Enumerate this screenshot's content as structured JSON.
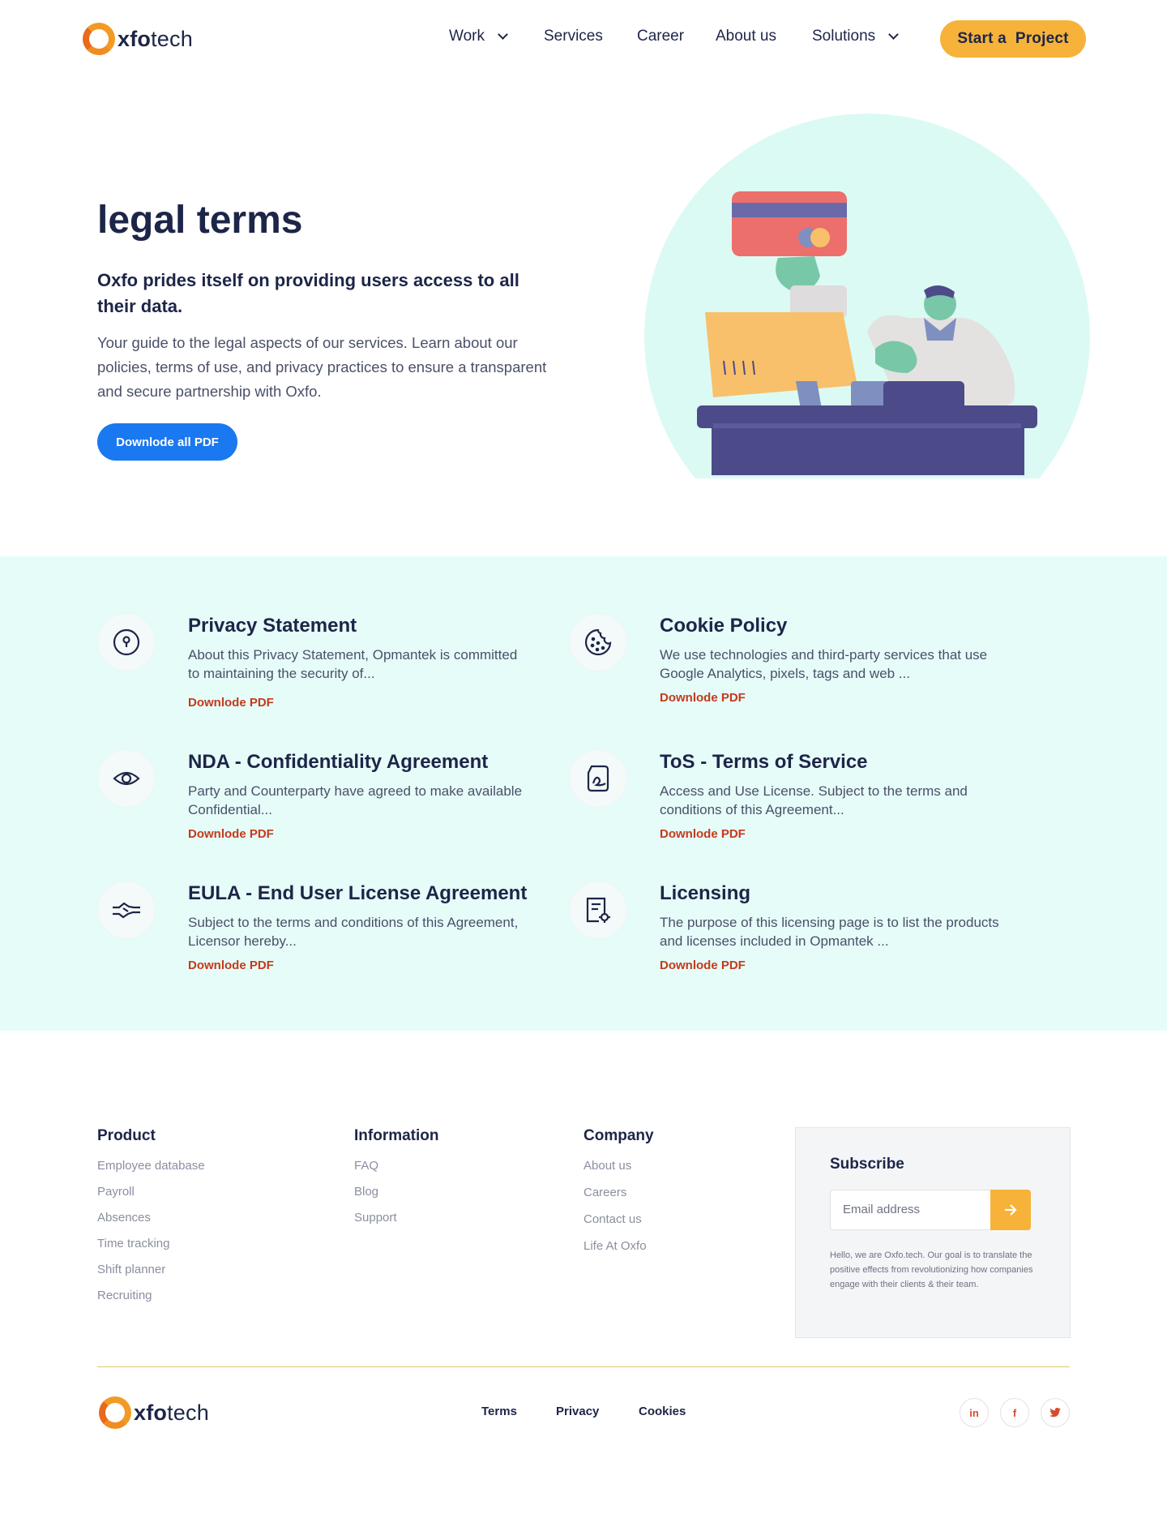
{
  "brand": {
    "logo_text_bold": "xfo",
    "logo_text_rest": "tech",
    "accent": "#f6b239",
    "link_color": "#c43a1a",
    "primary": "#1a78f0",
    "navy": "#1d2548"
  },
  "nav": {
    "items": [
      {
        "label": "Work",
        "has_dropdown": true
      },
      {
        "label": "Services",
        "has_dropdown": false
      },
      {
        "label": "Career",
        "has_dropdown": false
      },
      {
        "label": "About us",
        "has_dropdown": false
      },
      {
        "label": "Solutions",
        "has_dropdown": true
      }
    ],
    "cta": "Start a  Project"
  },
  "hero": {
    "title": "legal terms",
    "subtitle": "Oxfo prides itself on providing users access to all their data.",
    "description": "Your guide to the legal aspects of our services. Learn about our policies, terms of use, and privacy practices to ensure a transparent and secure partnership with Oxfo.",
    "button": "Downlode all PDF"
  },
  "documents": [
    {
      "icon": "keyhole-icon",
      "title": "Privacy Statement",
      "description": "About this Privacy Statement, Opmantek is committed to maintaining the security of...",
      "link": "Downlode PDF"
    },
    {
      "icon": "cookie-icon",
      "title": "Cookie Policy",
      "description": "We use technologies and third-party services that use Google Analytics, pixels, tags and web ...",
      "link": "Downlode PDF"
    },
    {
      "icon": "eye-icon",
      "title": "NDA - Confidentiality Agreement",
      "description": "Party and Counterparty have agreed to make available Confidential...",
      "link": "Downlode PDF"
    },
    {
      "icon": "signed-document-icon",
      "title": "ToS - Terms of Service",
      "description": "Access and Use License. Subject to the terms and conditions of this Agreement...",
      "link": "Downlode PDF"
    },
    {
      "icon": "handshake-icon",
      "title": "EULA - End User License Agreement",
      "description": "Subject to the terms and conditions of this Agreement, Licensor hereby...",
      "link": "Downlode PDF"
    },
    {
      "icon": "license-document-icon",
      "title": "Licensing",
      "description": "The purpose of this licensing page is to list the products and licenses included in Opmantek ...",
      "link": "Downlode PDF"
    }
  ],
  "footer": {
    "columns": [
      {
        "title": "Product",
        "items": [
          "Employee database",
          "Payroll",
          "Absences",
          "Time tracking",
          "Shift planner",
          "Recruiting"
        ]
      },
      {
        "title": "Information",
        "items": [
          "FAQ",
          "Blog",
          "Support"
        ]
      },
      {
        "title": "Company",
        "items": [
          "About us",
          "Careers",
          "Contact us",
          "Life At Oxfo"
        ]
      }
    ],
    "subscribe": {
      "title": "Subscribe",
      "placeholder": "Email address",
      "text": "Hello, we are Oxfo.tech. Our goal is to translate the positive effects from revolutionizing how companies engage with their clients & their team."
    },
    "legal_links": [
      "Terms",
      "Privacy",
      "Cookies"
    ],
    "social": [
      {
        "icon": "linkedin-icon",
        "glyph": "in"
      },
      {
        "icon": "facebook-icon",
        "glyph": "f"
      },
      {
        "icon": "twitter-icon",
        "glyph": "t"
      }
    ]
  }
}
